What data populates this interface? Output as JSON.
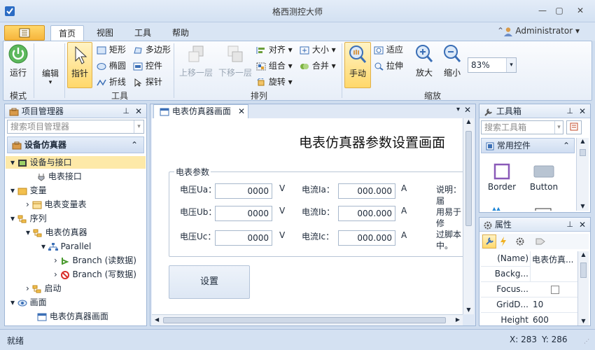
{
  "window": {
    "title": "格西测控大师"
  },
  "ribbon_tabs": [
    "首页",
    "视图",
    "工具",
    "帮助"
  ],
  "user": "Administrator",
  "ribbon": {
    "mode": {
      "run": "运行",
      "group": "模式"
    },
    "edit": {
      "edit": "编辑"
    },
    "tools": {
      "pointer": "指针",
      "rect": "矩形",
      "polygon": "多边形",
      "ellipse": "椭圆",
      "control": "控件",
      "polyline": "折线",
      "probe": "探针",
      "group": "工具"
    },
    "arrange": {
      "up": "上移一层",
      "down": "下移一层",
      "align": "对齐",
      "size": "大小",
      "combine": "组合",
      "merge": "合并",
      "rotate": "旋转",
      "group": "排列"
    },
    "zoom": {
      "hand": "手动",
      "fit": "适应",
      "stretch": "拉伸",
      "zoomin": "放大",
      "zoomout": "缩小",
      "value": "83%",
      "group": "缩放"
    }
  },
  "project_panel": {
    "title": "项目管理器",
    "search_placeholder": "搜索项目管理器",
    "root": "设备仿真器",
    "items": [
      "设备与接口",
      "电表接口",
      "变量",
      "电表变量表",
      "序列",
      "电表仿真器",
      "Parallel",
      "Branch (读数据)",
      "Branch (写数据)",
      "启动",
      "画面",
      "电表仿真器画面"
    ]
  },
  "document": {
    "tab": "电表仿真器画面",
    "heading": "电表仿真器参数设置画面",
    "group_title": "电表参数",
    "rows": [
      {
        "vlabel": "电压Ua：",
        "vvalue": "0000",
        "vunit": "V",
        "ilabel": "电流Ia：",
        "ivalue": "000.000",
        "iunit": "A"
      },
      {
        "vlabel": "电压Ub：",
        "vvalue": "0000",
        "vunit": "V",
        "ilabel": "电流Ib：",
        "ivalue": "000.000",
        "iunit": "A"
      },
      {
        "vlabel": "电压Uc：",
        "vvalue": "0000",
        "vunit": "V",
        "ilabel": "电流Ic：",
        "ivalue": "000.000",
        "iunit": "A"
      }
    ],
    "note": [
      "说明：届",
      "用易于修",
      "过脚本",
      "中。"
    ],
    "set_button": "设置"
  },
  "toolbox": {
    "title": "工具箱",
    "search_placeholder": "搜索工具箱",
    "category": "常用控件",
    "items": [
      "Border",
      "Button"
    ]
  },
  "properties": {
    "title": "属性",
    "rows": [
      {
        "name": "(Name)",
        "value": "电表仿真..."
      },
      {
        "name": "Backg...",
        "value": ""
      },
      {
        "name": "Focus...",
        "value": ""
      },
      {
        "name": "GridD...",
        "value": "10"
      },
      {
        "name": "Height",
        "value": "600"
      }
    ]
  },
  "statusbar": {
    "status": "就绪",
    "x": "X: 283",
    "y": "Y: 286"
  },
  "colors": {
    "accent": "#f6c04a",
    "ribbon_border": "#a9bfdc",
    "selected_row": "#fde9a8"
  }
}
